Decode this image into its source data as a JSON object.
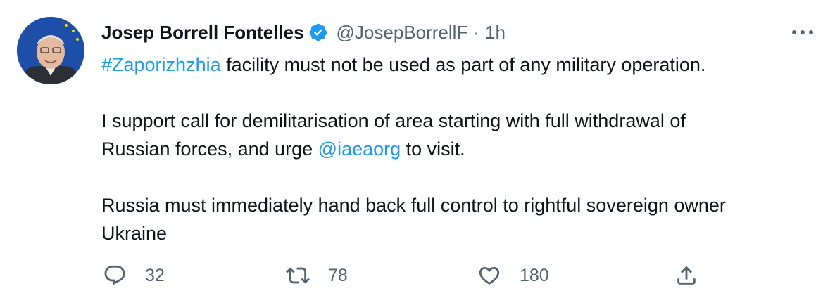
{
  "tweet": {
    "author": {
      "display_name": "Josep Borrell Fontelles",
      "verified_icon": "verified-badge-icon",
      "handle": "@JosepBorrellF",
      "separator": "·",
      "time": "1h"
    },
    "more_icon": "more-options-icon",
    "body": {
      "line1": {
        "hashtag": "#Zaporizhzhia",
        "text": " facility must not be used as part of any military operation."
      },
      "para2": {
        "line1": "I support call for demilitarisation of area starting with full withdrawal of",
        "line2_prefix": "Russian forces, and urge ",
        "mention": "@iaeaorg",
        "line2_suffix": " to visit."
      },
      "para3": {
        "line1": "Russia must immediately hand back full control to rightful sovereign owner",
        "line2": "Ukraine"
      }
    },
    "actions": {
      "reply": {
        "icon": "reply-icon",
        "count": "32"
      },
      "retweet": {
        "icon": "retweet-icon",
        "count": "78"
      },
      "like": {
        "icon": "heart-icon",
        "count": "180"
      },
      "share": {
        "icon": "share-icon"
      }
    },
    "colors": {
      "text": "#0f1419",
      "secondary": "#536471",
      "link": "#1d9bf0"
    }
  }
}
